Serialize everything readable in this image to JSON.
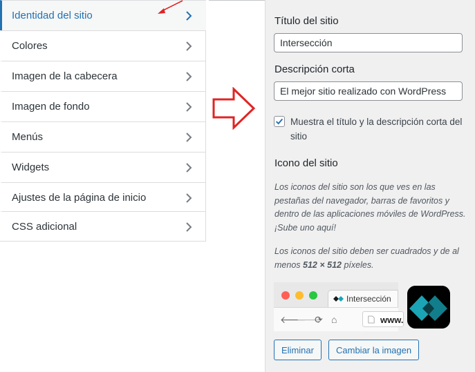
{
  "menu": {
    "items": [
      {
        "label": "Identidad del sitio",
        "active": true
      },
      {
        "label": "Colores"
      },
      {
        "label": "Imagen de la cabecera"
      },
      {
        "label": "Imagen de fondo"
      },
      {
        "label": "Menús"
      },
      {
        "label": "Widgets"
      },
      {
        "label": "Ajustes de la página de inicio"
      },
      {
        "label": "CSS adicional"
      }
    ]
  },
  "panel": {
    "site_title_label": "Título del sitio",
    "site_title_value": "Intersección",
    "tagline_label": "Descripción corta",
    "tagline_value": "El mejor sitio realizado con WordPress",
    "display_checkbox_label": "Muestra el título y la descripción corta del sitio",
    "display_checkbox_checked": true,
    "site_icon_heading": "Icono del sitio",
    "site_icon_desc": "Los iconos del sitio son los que ves en las pestañas del navegador, barras de favoritos y dentro de las aplicaciones móviles de WordPress. ¡Sube uno aquí!",
    "site_icon_req_prefix": "Los iconos del sitio deben ser cuadrados y de al menos",
    "site_icon_req_size": "512 × 512",
    "site_icon_req_suffix": "píxeles.",
    "preview_tab_title": "Intersección",
    "preview_url": "www.",
    "remove_button": "Eliminar",
    "change_button": "Cambiar la imagen"
  },
  "colors": {
    "accent": "#2271b1",
    "annotation_red": "#e02424",
    "panel_bg": "#f0f0f1",
    "site_icon_teal": "#1aa4b6"
  },
  "icons": [
    "chevron-right-icon",
    "checkmark-icon",
    "back-arrow-icon",
    "forward-arrow-icon",
    "reload-icon",
    "home-icon",
    "page-icon",
    "tab-favicon-icon",
    "site-icon-logo"
  ]
}
